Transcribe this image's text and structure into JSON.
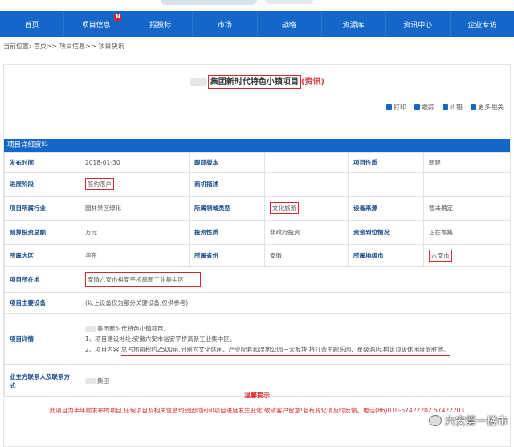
{
  "nav": {
    "items": [
      "首页",
      "项目信息",
      "招投标",
      "市场",
      "战略",
      "资源库",
      "资讯中心",
      "企业专访"
    ],
    "badge": "N"
  },
  "breadcrumb": {
    "prefix": "当前位置:",
    "home": "首页",
    "sep1": ">>",
    "level1": "项目信息",
    "sep2": ">>",
    "level2": "项目快讯"
  },
  "article": {
    "title_main": "集团新时代特色小镇项目",
    "title_suffix": "(资讯)"
  },
  "actions": [
    "打印",
    "跟踪",
    "纠错",
    "更多相关"
  ],
  "section_title": "项目详细资料",
  "table": {
    "r1": {
      "l1": "发布时间",
      "v1": "2018-01-30",
      "l2": "跟踪版本",
      "v2": "",
      "l3": "项目性质",
      "v3": "新建"
    },
    "r2": {
      "l1": "进展阶段",
      "v1": "签约落户",
      "l2": "商机描述",
      "v2": "",
      "l3": "",
      "v3": ""
    },
    "r3": {
      "l1": "项目所属行业",
      "v1": "园林景区绿化",
      "l2": "所属领域类型",
      "v2": "文化旅游",
      "l3": "设备来源",
      "v3": "暂未确定"
    },
    "r4": {
      "l1": "预算投资总额",
      "v1": "万元",
      "l2": "投资性质",
      "v2": "非政府投资",
      "l3": "资金到位情况",
      "v3": "正在筹集"
    },
    "r5": {
      "l1": "所属大区",
      "v1": "华东",
      "l2": "所属省份",
      "v2": "安徽",
      "l3": "所属地级市",
      "v3": "六安市"
    },
    "r6": {
      "l1": "项目所在地",
      "v1": "安徽六安市裕安平桥高新工业集中区"
    },
    "r7": {
      "l1": "项目主要设备",
      "v1": "(以上设备仅为部分关键设备,仅供参考)"
    },
    "r8": {
      "l1": "项目详情",
      "line1": "集团新时代特色小镇项目,",
      "line2": "1、项目建设地址:安徽六安市裕安平桥高新工业集中区。",
      "line3a": "2、项目内容:",
      "line3b": "总占地面积约2500亩,分别为文化休闲、产业配套和湿地公园三大板块,将打造主题乐园、星级酒店,构筑顶级休闲度假胜地。"
    },
    "r9": {
      "l1": "业主方联系人及联系方式",
      "v1": "集团"
    }
  },
  "notice": {
    "title": "温馨提示",
    "body": "此项目为半年前发布的项目,任何项目及相关信息均会因时间和项目进度发生变化,敬请客户留意!若有变化请及时反馈。电话(86)010-57422202 57422203"
  },
  "watermark": "六安第一楼市"
}
